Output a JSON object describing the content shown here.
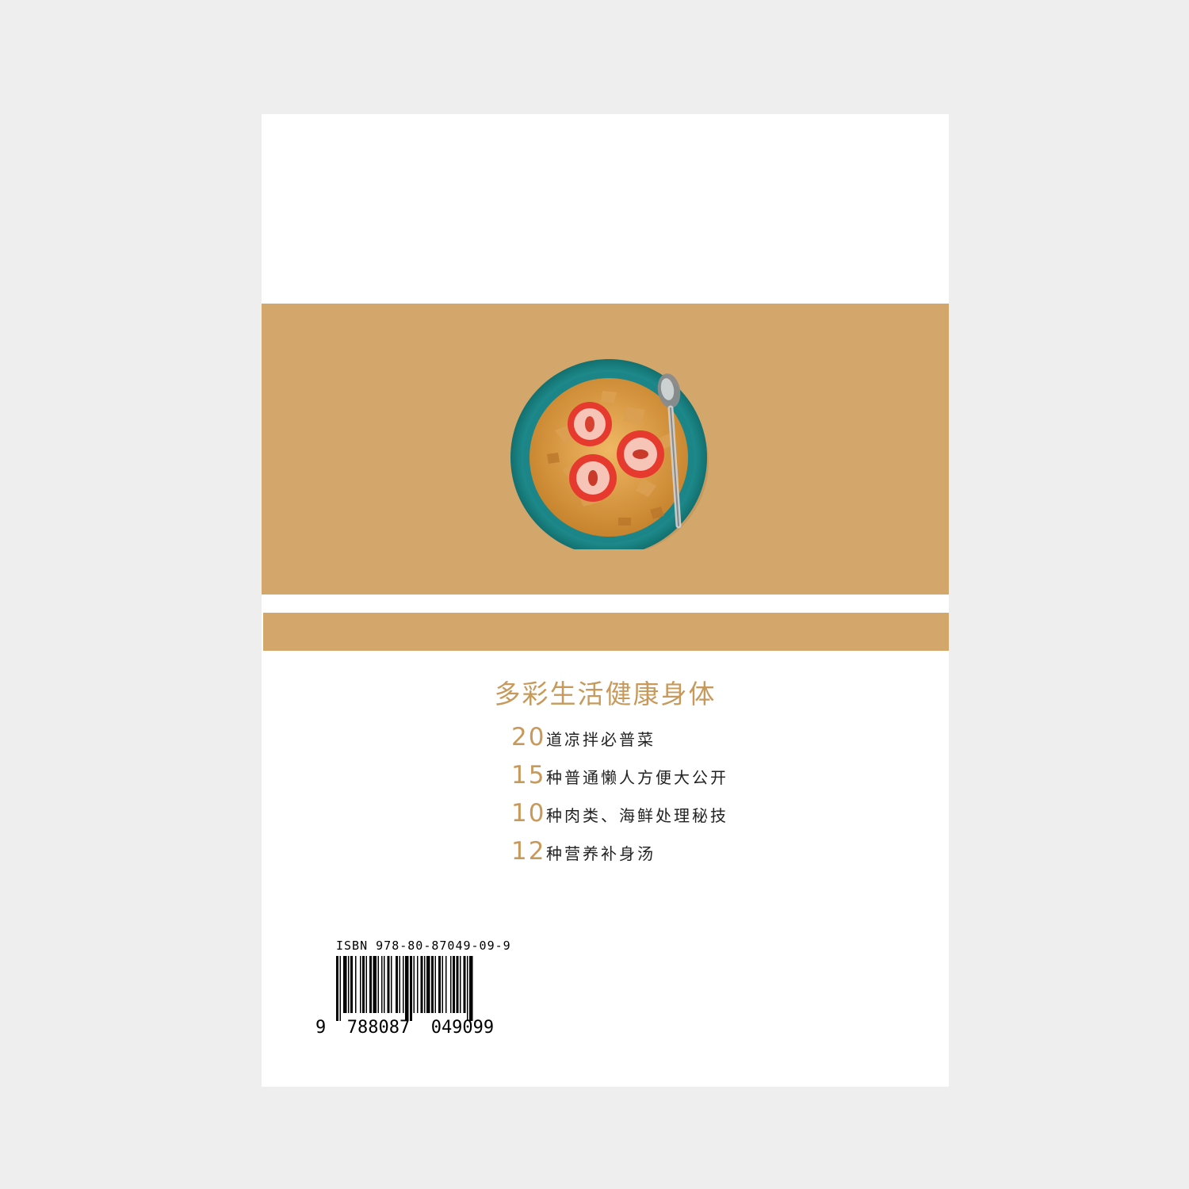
{
  "colors": {
    "accent": "#d3a66c",
    "accent_text": "#c79a5c",
    "bowl": "#23959a"
  },
  "images": {
    "bowl": "cereal-bowl-with-strawberries"
  },
  "slogan": "多彩生活健康身体",
  "features": [
    {
      "num": "20",
      "text": "道凉拌必普菜"
    },
    {
      "num": "15",
      "text": "种普通懒人方便大公开"
    },
    {
      "num": "10",
      "text": "种肉类、海鲜处理秘技"
    },
    {
      "num": "12",
      "text": "种营养补身汤"
    }
  ],
  "isbn": {
    "label": "ISBN  978-80-87049-09-9",
    "digits": "9  788087  049099"
  }
}
